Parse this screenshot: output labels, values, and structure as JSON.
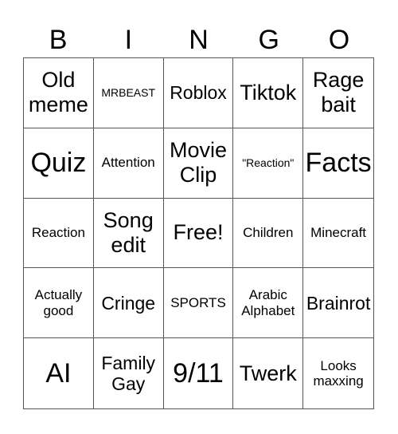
{
  "title_letters": [
    "B",
    "I",
    "N",
    "G",
    "O"
  ],
  "cells": [
    {
      "text": "Old meme",
      "size": "xl"
    },
    {
      "text": "MRBEAST",
      "size": "s"
    },
    {
      "text": "Roblox",
      "size": "l"
    },
    {
      "text": "Tiktok",
      "size": "xl"
    },
    {
      "text": "Rage bait",
      "size": "xl"
    },
    {
      "text": "Quiz",
      "size": "xxl"
    },
    {
      "text": "Attention",
      "size": "m"
    },
    {
      "text": "Movie Clip",
      "size": "xl"
    },
    {
      "text": "\"Reaction\"",
      "size": "s"
    },
    {
      "text": "Facts",
      "size": "xxl"
    },
    {
      "text": "Reaction",
      "size": "m"
    },
    {
      "text": "Song edit",
      "size": "xl"
    },
    {
      "text": "Free!",
      "size": "xl"
    },
    {
      "text": "Children",
      "size": "m"
    },
    {
      "text": "Minecraft",
      "size": "m"
    },
    {
      "text": "Actually good",
      "size": "m"
    },
    {
      "text": "Cringe",
      "size": "l"
    },
    {
      "text": "SPORTS",
      "size": "m"
    },
    {
      "text": "Arabic Alphabet",
      "size": "m"
    },
    {
      "text": "Brainrot",
      "size": "l"
    },
    {
      "text": "AI",
      "size": "xxl"
    },
    {
      "text": "Family Gay",
      "size": "l"
    },
    {
      "text": "9/11",
      "size": "xxl"
    },
    {
      "text": "Twerk",
      "size": "xl"
    },
    {
      "text": "Looks maxxing",
      "size": "m"
    }
  ]
}
